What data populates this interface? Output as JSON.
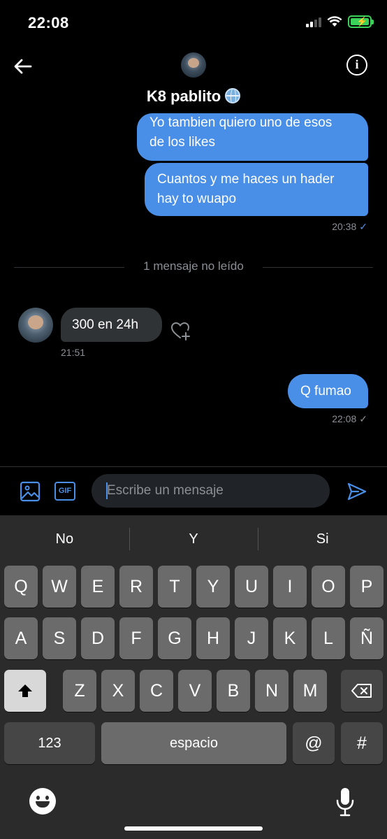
{
  "status_bar": {
    "time": "22:08"
  },
  "header": {
    "contact_name": "K8 pablito"
  },
  "messages": [
    {
      "direction": "out",
      "lines": [
        "Yo tambien quiero uno de esos",
        "de los likes"
      ]
    },
    {
      "direction": "out",
      "lines": [
        "Cuantos y me haces un hader",
        "hay to wuapo"
      ],
      "time": "20:38"
    },
    {
      "direction": "in",
      "text": "300 en 24h",
      "time": "21:51"
    },
    {
      "direction": "out",
      "text": "Q fumao",
      "time": "22:08"
    }
  ],
  "divider": {
    "label": "1 mensaje no leído"
  },
  "composer": {
    "placeholder": "Escribe un mensaje",
    "gif_label": "GIF"
  },
  "keyboard": {
    "suggestions": [
      "No",
      "Y",
      "Si"
    ],
    "row1": [
      "Q",
      "W",
      "E",
      "R",
      "T",
      "Y",
      "U",
      "I",
      "O",
      "P"
    ],
    "row2": [
      "A",
      "S",
      "D",
      "F",
      "G",
      "H",
      "J",
      "K",
      "L",
      "Ñ"
    ],
    "row3": [
      "Z",
      "X",
      "C",
      "V",
      "B",
      "N",
      "M"
    ],
    "numbers_label": "123",
    "space_label": "espacio",
    "at_label": "@",
    "hash_label": "#"
  },
  "icons": {
    "back": "arrow-left-icon",
    "info": "info-icon",
    "media": "image-icon",
    "gif": "gif-icon",
    "send": "send-icon",
    "heart_add": "heart-plus-icon",
    "shift": "shift-icon",
    "delete": "backspace-icon",
    "emoji": "emoji-icon",
    "mic": "microphone-icon"
  },
  "colors": {
    "accent": "#4a8fe7",
    "incoming_bubble": "#2f3336",
    "background": "#000000"
  }
}
